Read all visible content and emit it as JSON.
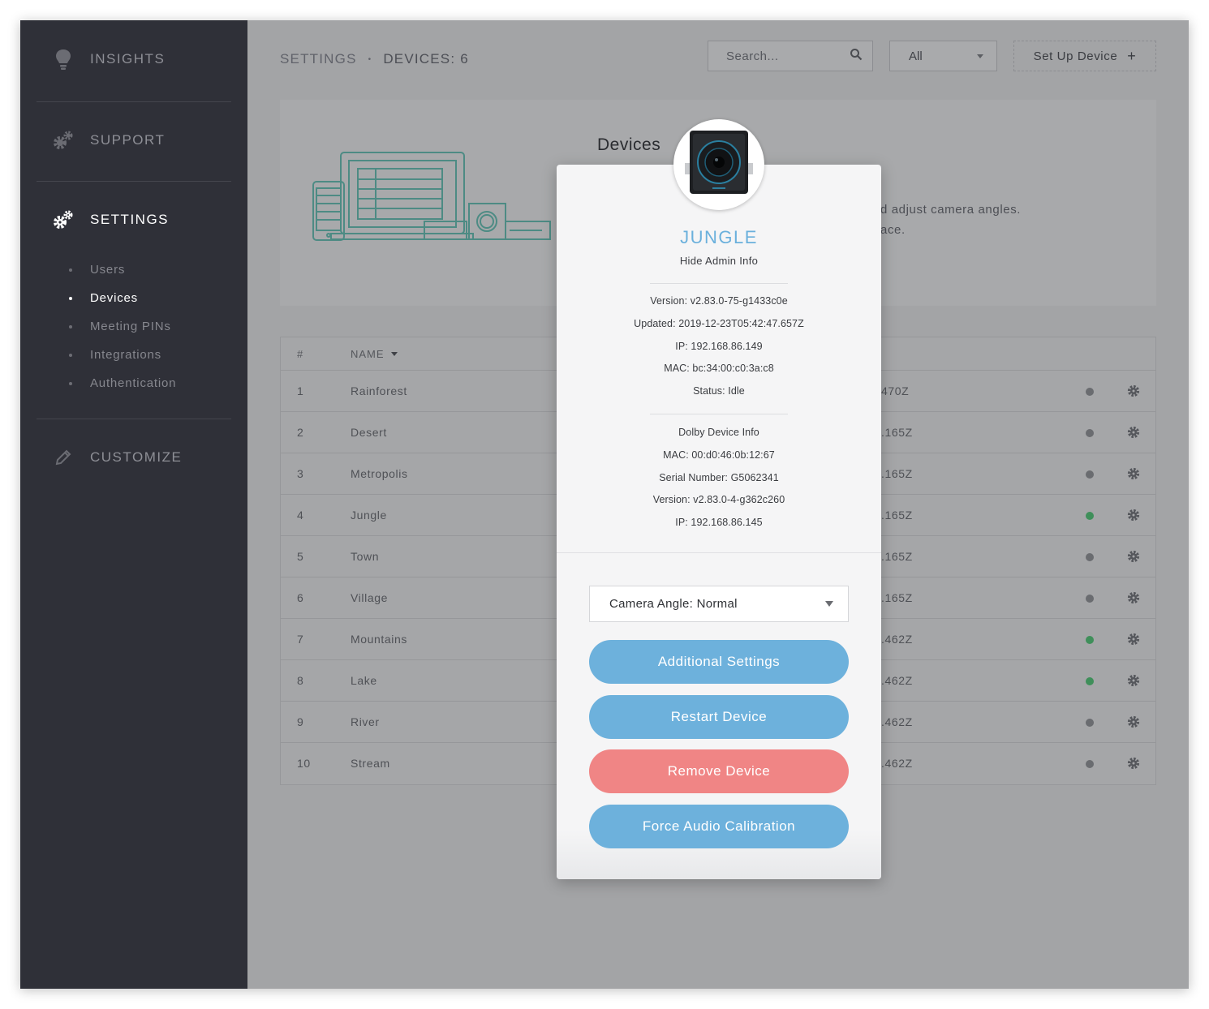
{
  "sidebar": {
    "items": [
      {
        "label": "INSIGHTS",
        "icon": "lightbulb-icon"
      },
      {
        "label": "SUPPORT",
        "icon": "gears-icon"
      },
      {
        "label": "SETTINGS",
        "icon": "gears-icon"
      },
      {
        "label": "CUSTOMIZE",
        "icon": "pencil-icon"
      }
    ],
    "sub_items": [
      "Users",
      "Devices",
      "Meeting PINs",
      "Integrations",
      "Authentication"
    ]
  },
  "header": {
    "breadcrumb_root": "SETTINGS",
    "breadcrumb_sep": "•",
    "breadcrumb_current": "DEVICES: 6",
    "search_placeholder": "Search...",
    "filter_value": "All",
    "setup_label": "Set Up Device",
    "setup_plus": "+"
  },
  "info_card": {
    "title": "Devices",
    "desc_line1": "d adjust camera angles.",
    "desc_line2": "ace."
  },
  "table": {
    "headers": {
      "num": "#",
      "name": "NAME"
    },
    "rows": [
      {
        "num": "1",
        "name": "Rainforest",
        "time": "470Z",
        "online": false
      },
      {
        "num": "2",
        "name": "Desert",
        "time": ".165Z",
        "online": false
      },
      {
        "num": "3",
        "name": "Metropolis",
        "time": ".165Z",
        "online": false
      },
      {
        "num": "4",
        "name": "Jungle",
        "time": ".165Z",
        "online": true
      },
      {
        "num": "5",
        "name": "Town",
        "time": ".165Z",
        "online": false
      },
      {
        "num": "6",
        "name": "Village",
        "time": ".165Z",
        "online": false
      },
      {
        "num": "7",
        "name": "Mountains",
        "time": ".462Z",
        "online": true
      },
      {
        "num": "8",
        "name": "Lake",
        "time": ".462Z",
        "online": true
      },
      {
        "num": "9",
        "name": "River",
        "time": ".462Z",
        "online": false
      },
      {
        "num": "10",
        "name": "Stream",
        "time": ".462Z",
        "online": false
      }
    ]
  },
  "modal": {
    "device_name": "JUNGLE",
    "hide_admin": "Hide Admin Info",
    "admin_info": [
      "Version: v2.83.0-75-g1433c0e",
      "Updated: 2019-12-23T05:42:47.657Z",
      "IP: 192.168.86.149",
      "MAC: bc:34:00:c0:3a:c8",
      "Status: Idle"
    ],
    "dolby_info": [
      "Dolby Device Info",
      "MAC: 00:d0:46:0b:12:67",
      "Serial Number: G5062341",
      "Version: v2.83.0-4-g362c260",
      "IP: 192.168.86.145"
    ],
    "camera_angle": "Camera Angle: Normal",
    "buttons": {
      "additional": "Additional Settings",
      "restart": "Restart Device",
      "remove": "Remove Device",
      "calibrate": "Force Audio Calibration"
    }
  },
  "colors": {
    "sidebar_bg": "#2f3038",
    "overlay_bg": "#a3a4a6",
    "accent_blue": "#6db1dc",
    "danger_red": "#f08585",
    "online_green": "#3f8f5a"
  }
}
